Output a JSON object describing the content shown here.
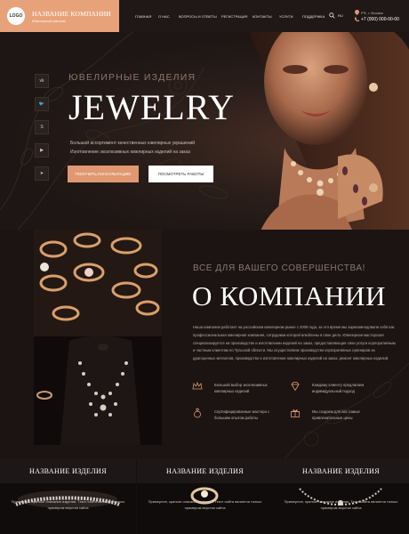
{
  "brand": {
    "logo": "LOGO",
    "name": "НАЗВАНИЕ КОМПАНИИ",
    "tagline": "Ювелирный магазин"
  },
  "nav": [
    "ГЛАВНАЯ",
    "О НАС",
    "ВОПРОСЫ И ОТВЕТЫ",
    "РЕГИСТРАЦИЯ",
    "КОНТАКТЫ",
    "УСЛУГИ",
    "ПОДДЕРЖКА"
  ],
  "contact": {
    "lang": "RU",
    "location": "РФ, г. Москва",
    "phone": "+7 (000) 000-00-00"
  },
  "social": [
    "vk-icon",
    "twitter-icon",
    "skype-icon",
    "youtube-icon",
    "telegram-icon"
  ],
  "hero": {
    "kicker": "ЮВЕЛИРНЫЕ ИЗДЕЛИЯ",
    "title": "JEWELRY",
    "line1": "Большой ассортимент качественных ювелирных украшений",
    "line2": "Изготовление эксклюзивных ювелирных изделий на заказ",
    "btn_primary": "ПОЛУЧИТЬ КОНСУЛЬТАЦИЮ",
    "btn_secondary": "ПОСМОТРЕТЬ РАБОТЫ"
  },
  "about": {
    "kicker": "ВСЕ ДЛЯ ВАШЕГО СОВЕРШЕНСТВА!",
    "title": "О КОМПАНИИ",
    "text": "Наша компания работает на российском ювелирном рынке с 2009 года, за это время мы зарекомендовали себя как профессиональная ювелирная компания, сотрудники которой влюблены в свое дело. Ювелирная мастерская специализируется на производстве и изготовлении изделий на заказ, предоставляющая свои услуги корпоративным и частным клиентам по Тульской области. Мы осуществляем производство корпоративных сувениров из драгоценных металлов, производство и изготовление ювелирных изделий на заказ, ремонт ювелирных изделий.",
    "features": [
      {
        "icon": "crown-icon",
        "text": "Большой выбор эксклюзивных ювелирных изделий"
      },
      {
        "icon": "diamond-icon",
        "text": "Каждому клиенту предлагаем индивидуальный подход"
      },
      {
        "icon": "ring-icon",
        "text": "Сертифицированные мастера с большим опытом работы"
      },
      {
        "icon": "gift-icon",
        "text": "Мы создаем для вас самые привлекательные цены"
      }
    ]
  },
  "products": [
    {
      "title": "НАЗВАНИЕ ИЗДЕЛИЯ",
      "text": "Примерное, краткое описание изделия. Текст сайта является только примером верстки сайта"
    },
    {
      "title": "НАЗВАНИЕ ИЗДЕЛИЯ",
      "text": "Примерное, краткое описание изделия. Текст сайта является только примером верстки сайта"
    },
    {
      "title": "НАЗВАНИЕ ИЗДЕЛИЯ",
      "text": "Примерное, краткое описание изделия. Текст сайта является только примером верстки сайта"
    }
  ],
  "colors": {
    "accent": "#e09870",
    "brand_bg": "#e8a27a",
    "dark": "#1c1513"
  }
}
